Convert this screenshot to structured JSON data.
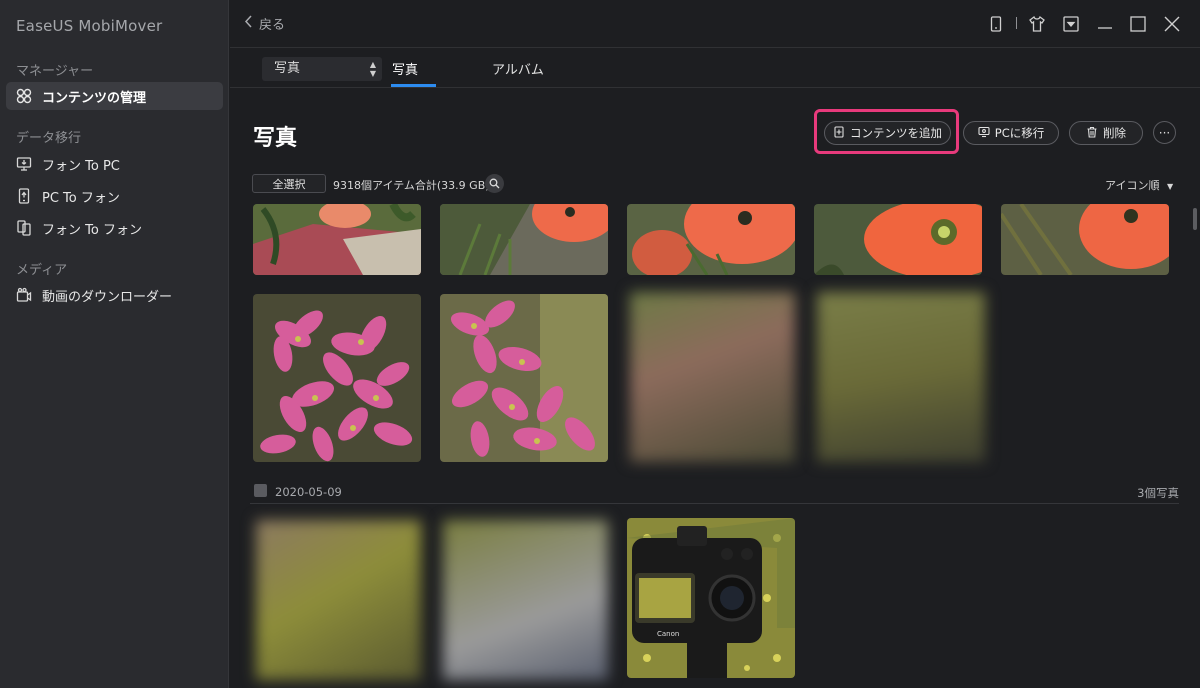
{
  "app": {
    "title": "EaseUS MobiMover"
  },
  "sidebar": {
    "sections": [
      {
        "label": "マネージャー"
      },
      {
        "label": "データ移行"
      },
      {
        "label": "メディア"
      }
    ],
    "items": [
      {
        "label": "コンテンツの管理",
        "icon": "grid-icon",
        "active": true
      },
      {
        "label": "フォン To PC",
        "icon": "phone-to-pc-icon"
      },
      {
        "label": "PC To フォン",
        "icon": "pc-to-phone-icon"
      },
      {
        "label": "フォン To フォン",
        "icon": "phone-to-phone-icon"
      },
      {
        "label": "動画のダウンローダー",
        "icon": "video-download-icon"
      }
    ]
  },
  "header": {
    "back_label": "戻る",
    "icons": [
      "phone-icon",
      "tshirt-icon",
      "dropdown-box-icon",
      "minimize-icon",
      "maximize-icon",
      "close-icon"
    ]
  },
  "tabs": {
    "category_select": "写真",
    "items": [
      {
        "label": "写真",
        "active": true
      },
      {
        "label": "アルバム",
        "active": false
      }
    ]
  },
  "main": {
    "title": "写真",
    "add_button": "コンテンツを追加",
    "to_pc_button": "PCに移行",
    "delete_button": "削除",
    "more_button": "···",
    "select_all": "全選択",
    "count": "9318個アイテム合計(33.9 GB)",
    "sort": "アイコン順",
    "date_group": {
      "date": "2020-05-09",
      "count": "3個写真"
    }
  },
  "colors": {
    "accent": "#2d8cf0",
    "highlight": "#e83a7c",
    "background": "#1d1e21",
    "sidebar": "#2a2b2f"
  }
}
